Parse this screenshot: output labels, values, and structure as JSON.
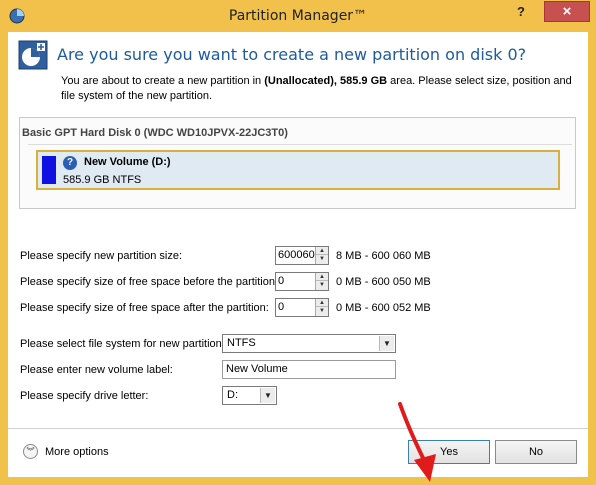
{
  "window": {
    "title": "Partition Manager™",
    "help_label": "?",
    "close_label": "×"
  },
  "header": {
    "title": "Are you sure you want to create a new partition on disk 0?",
    "desc_pre": "You are about to create a new partition in ",
    "desc_bold": "(Unallocated), 585.9 GB",
    "desc_post": " area. Please select size, position and file system of the new partition."
  },
  "disk": {
    "title": "Basic GPT Hard Disk 0 (WDC WD10JPVX-22JC3T0)",
    "partition_name": "New Volume (D:)",
    "partition_info": "585.9 GB NTFS",
    "partition_color": "#1010e0"
  },
  "form": {
    "size_label": "Please specify new partition size:",
    "size_value": "600060",
    "size_range": "8 MB - 600 060 MB",
    "before_label": "Please specify size of free space before the partition:",
    "before_value": "0",
    "before_range": "0 MB - 600 050 MB",
    "after_label": "Please specify size of free space after the partition:",
    "after_value": "0",
    "after_range": "0 MB - 600 052 MB",
    "fs_label": "Please select file system for new partition:",
    "fs_value": "NTFS",
    "volume_label_label": "Please enter new volume label:",
    "volume_label_value": "New Volume",
    "drive_letter_label": "Please specify drive letter:",
    "drive_letter_value": "D:"
  },
  "footer": {
    "more_options_label": "More options",
    "yes_label": "Yes",
    "no_label": "No"
  }
}
